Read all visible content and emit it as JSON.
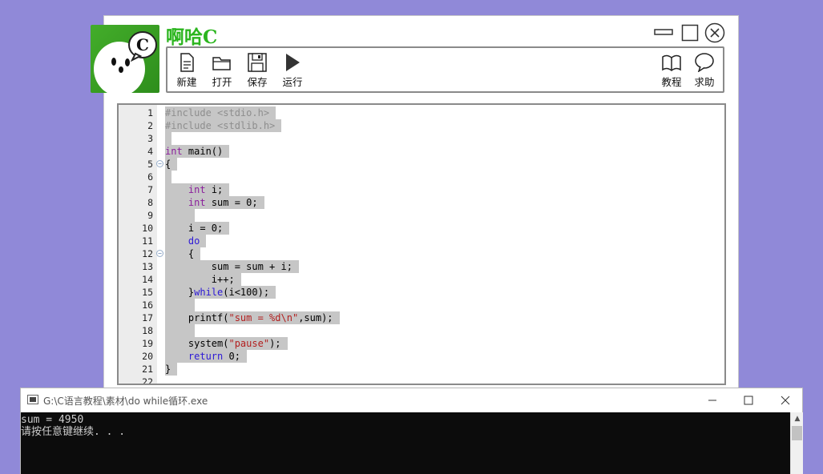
{
  "app": {
    "title": "啊哈C",
    "logo_letter": "C"
  },
  "toolbar": {
    "new_label": "新建",
    "open_label": "打开",
    "save_label": "保存",
    "run_label": "运行",
    "tutorial_label": "教程",
    "help_label": "求助"
  },
  "editor": {
    "lines": [
      {
        "n": "1",
        "tokens": [
          {
            "c": "pp",
            "t": "#include <stdio.h>"
          }
        ]
      },
      {
        "n": "2",
        "tokens": [
          {
            "c": "pp",
            "t": "#include <stdlib.h>"
          }
        ]
      },
      {
        "n": "3",
        "tokens": [
          {
            "c": "tx",
            "t": ""
          }
        ]
      },
      {
        "n": "4",
        "tokens": [
          {
            "c": "ty",
            "t": "int"
          },
          {
            "c": "tx",
            "t": " main()"
          }
        ]
      },
      {
        "n": "5",
        "fold": true,
        "tokens": [
          {
            "c": "tx",
            "t": "{"
          }
        ]
      },
      {
        "n": "6",
        "tokens": [
          {
            "c": "tx",
            "t": ""
          }
        ]
      },
      {
        "n": "7",
        "tokens": [
          {
            "c": "tx",
            "t": "    "
          },
          {
            "c": "ty",
            "t": "int"
          },
          {
            "c": "tx",
            "t": " i;"
          }
        ]
      },
      {
        "n": "8",
        "tokens": [
          {
            "c": "tx",
            "t": "    "
          },
          {
            "c": "ty",
            "t": "int"
          },
          {
            "c": "tx",
            "t": " sum = 0;"
          }
        ]
      },
      {
        "n": "9",
        "tokens": [
          {
            "c": "tx",
            "t": "    "
          }
        ]
      },
      {
        "n": "10",
        "tokens": [
          {
            "c": "tx",
            "t": "    i = 0;"
          }
        ]
      },
      {
        "n": "11",
        "tokens": [
          {
            "c": "tx",
            "t": "    "
          },
          {
            "c": "kw",
            "t": "do"
          }
        ]
      },
      {
        "n": "12",
        "fold": true,
        "tokens": [
          {
            "c": "tx",
            "t": "    {"
          }
        ]
      },
      {
        "n": "13",
        "tokens": [
          {
            "c": "tx",
            "t": "        sum = sum + i;"
          }
        ]
      },
      {
        "n": "14",
        "tokens": [
          {
            "c": "tx",
            "t": "        i++;"
          }
        ]
      },
      {
        "n": "15",
        "tokens": [
          {
            "c": "tx",
            "t": "    }"
          },
          {
            "c": "kw",
            "t": "while"
          },
          {
            "c": "tx",
            "t": "(i<100);"
          }
        ]
      },
      {
        "n": "16",
        "tokens": [
          {
            "c": "tx",
            "t": "    "
          }
        ]
      },
      {
        "n": "17",
        "tokens": [
          {
            "c": "tx",
            "t": "    printf("
          },
          {
            "c": "st",
            "t": "\"sum = %d\\n\""
          },
          {
            "c": "tx",
            "t": ",sum);"
          }
        ]
      },
      {
        "n": "18",
        "tokens": [
          {
            "c": "tx",
            "t": "    "
          }
        ]
      },
      {
        "n": "19",
        "tokens": [
          {
            "c": "tx",
            "t": "    system("
          },
          {
            "c": "st",
            "t": "\"pause\""
          },
          {
            "c": "tx",
            "t": ");"
          }
        ]
      },
      {
        "n": "20",
        "tokens": [
          {
            "c": "tx",
            "t": "    "
          },
          {
            "c": "kw",
            "t": "return"
          },
          {
            "c": "tx",
            "t": " 0;"
          }
        ]
      },
      {
        "n": "21",
        "tokens": [
          {
            "c": "tx",
            "t": "}"
          }
        ]
      },
      {
        "n": "22",
        "tokens": []
      }
    ]
  },
  "console": {
    "title": "G:\\C语言教程\\素材\\do while循环.exe",
    "output_line1": "sum = 4950",
    "output_line2": "请按任意键继续. . ."
  }
}
